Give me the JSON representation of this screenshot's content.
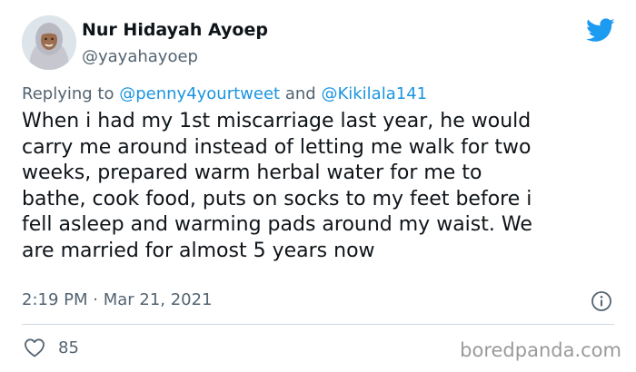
{
  "author": {
    "display_name": "Nur Hidayah Ayoep",
    "handle": "@yayahayoep"
  },
  "reply": {
    "prefix": "Replying to",
    "mention_1": "@penny4yourtweet",
    "conjunction": "and",
    "mention_2": "@Kikilala141"
  },
  "tweet": {
    "text": "When i had my 1st miscarriage last year, he would\ncarry me around instead of letting me walk for two\nweeks, prepared warm herbal water for me to\nbathe, cook food, puts on socks to my feet before i\nfell asleep and warming pads around my waist. We\nare married for almost 5 years now",
    "timestamp": "2:19 PM · Mar 21, 2021"
  },
  "actions": {
    "like_count": "85"
  },
  "watermark": "boredpanda.com",
  "icons": {
    "brand": "twitter-bird-icon",
    "info": "info-icon",
    "like": "heart-icon"
  },
  "colors": {
    "twitter_blue": "#1d9bf0",
    "mention_blue": "#1b95e0",
    "secondary_text": "#536471"
  }
}
